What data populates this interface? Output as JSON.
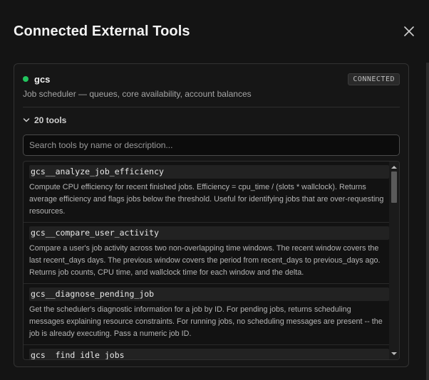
{
  "dialog": {
    "title": "Connected External Tools",
    "close_icon": "close-icon"
  },
  "server": {
    "name": "gcs",
    "status_badge": "CONNECTED",
    "status_color": "#22c55e",
    "description": "Job scheduler — queues, core availability, account balances"
  },
  "tools": {
    "count_label": "20 tools",
    "toggle_icon": "chevron-down-icon",
    "search_placeholder": "Search tools by name or description...",
    "items": [
      {
        "name": "gcs__analyze_job_efficiency",
        "description": "Compute CPU efficiency for recent finished jobs. Efficiency = cpu_time / (slots * wallclock). Returns average efficiency and flags jobs below the threshold. Useful for identifying jobs that are over-requesting resources."
      },
      {
        "name": "gcs__compare_user_activity",
        "description": "Compare a user's job activity across two non-overlapping time windows. The recent window covers the last recent_days days. The previous window covers the period from recent_days to previous_days ago. Returns job counts, CPU time, and wallclock time for each window and the delta."
      },
      {
        "name": "gcs__diagnose_pending_job",
        "description": "Get the scheduler's diagnostic information for a job by ID. For pending jobs, returns scheduling messages explaining resource constraints. For running jobs, no scheduling messages are present -- the job is already executing. Pass a numeric job ID."
      },
      {
        "name": "gcs__find_idle_jobs",
        "description": ""
      }
    ]
  }
}
